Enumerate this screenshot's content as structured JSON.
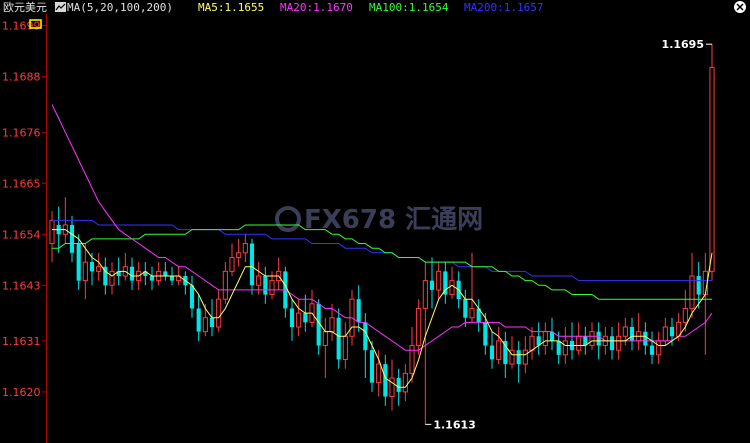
{
  "header": {
    "symbol": "欧元美元",
    "indicator": "MA(5,20,100,200)",
    "ma5": "MA5:1.1655",
    "ma20": "MA20:1.1670",
    "ma100": "MA100:1.1654",
    "ma200": "MA200:1.1657",
    "ma_icon": "line-chart-icon",
    "tool_icon": "square-tool-icon"
  },
  "watermark": "FX678 汇通网",
  "colors": {
    "background": "#000000",
    "axis": "#b00000",
    "up": "#ff3b3b",
    "down": "#00e5e5",
    "ma5": "#ffff66",
    "ma20": "#ff33ff",
    "ma100": "#33ff33",
    "ma200": "#3333ff"
  },
  "chart_data": {
    "type": "candlestick",
    "ylim": [
      1.1612,
      1.17
    ],
    "y_ticks": [
      "1.1699",
      "1.1688",
      "1.1676",
      "1.1665",
      "1.1654",
      "1.1643",
      "1.1631",
      "1.1620"
    ],
    "annotations": [
      {
        "text": "1.1695",
        "value": 1.1695,
        "index": 99
      },
      {
        "text": "1.1613",
        "value": 1.1613,
        "index": 56
      }
    ],
    "candles": [
      [
        1.1652,
        1.1657,
        1.1659,
        1.1648
      ],
      [
        1.1656,
        1.1654,
        1.166,
        1.165
      ],
      [
        1.1654,
        1.1656,
        1.1662,
        1.1652
      ],
      [
        1.1656,
        1.165,
        1.1658,
        1.1648
      ],
      [
        1.1652,
        1.1644,
        1.1654,
        1.1642
      ],
      [
        1.1644,
        1.1648,
        1.1652,
        1.164
      ],
      [
        1.1648,
        1.1646,
        1.165,
        1.1643
      ],
      [
        1.1646,
        1.1647,
        1.165,
        1.1644
      ],
      [
        1.1647,
        1.1643,
        1.1649,
        1.1641
      ],
      [
        1.1643,
        1.1646,
        1.1648,
        1.1641
      ],
      [
        1.1646,
        1.1645,
        1.1649,
        1.1643
      ],
      [
        1.1645,
        1.1647,
        1.165,
        1.1644
      ],
      [
        1.1647,
        1.1644,
        1.1649,
        1.1642
      ],
      [
        1.1644,
        1.1646,
        1.1648,
        1.1642
      ],
      [
        1.1646,
        1.1645,
        1.1648,
        1.1643
      ],
      [
        1.1645,
        1.1644,
        1.1647,
        1.1642
      ],
      [
        1.1644,
        1.1646,
        1.1648,
        1.1643
      ],
      [
        1.1646,
        1.1645,
        1.1648,
        1.1644
      ],
      [
        1.1645,
        1.1644,
        1.1647,
        1.1643
      ],
      [
        1.1644,
        1.1645,
        1.1647,
        1.1643
      ],
      [
        1.1645,
        1.1643,
        1.1646,
        1.1641
      ],
      [
        1.1643,
        1.1638,
        1.1645,
        1.1636
      ],
      [
        1.1638,
        1.1633,
        1.1641,
        1.1631
      ],
      [
        1.1633,
        1.1636,
        1.1639,
        1.1632
      ],
      [
        1.1636,
        1.1634,
        1.164,
        1.1632
      ],
      [
        1.1634,
        1.164,
        1.1642,
        1.1633
      ],
      [
        1.164,
        1.1646,
        1.1648,
        1.1639
      ],
      [
        1.1646,
        1.1649,
        1.1652,
        1.1645
      ],
      [
        1.1649,
        1.165,
        1.1653,
        1.1647
      ],
      [
        1.165,
        1.1652,
        1.1654,
        1.1648
      ],
      [
        1.1652,
        1.1643,
        1.1653,
        1.1641
      ],
      [
        1.1643,
        1.1645,
        1.1648,
        1.1641
      ],
      [
        1.1645,
        1.1641,
        1.1647,
        1.1639
      ],
      [
        1.1641,
        1.1644,
        1.1646,
        1.164
      ],
      [
        1.1644,
        1.1646,
        1.1649,
        1.1642
      ],
      [
        1.1646,
        1.1638,
        1.1647,
        1.1636
      ],
      [
        1.1638,
        1.1634,
        1.164,
        1.1631
      ],
      [
        1.1634,
        1.1637,
        1.164,
        1.1632
      ],
      [
        1.1637,
        1.1635,
        1.1641,
        1.1633
      ],
      [
        1.1635,
        1.1639,
        1.1642,
        1.1634
      ],
      [
        1.1639,
        1.163,
        1.164,
        1.1628
      ],
      [
        1.163,
        1.1633,
        1.1636,
        1.1623
      ],
      [
        1.1633,
        1.1636,
        1.1639,
        1.1631
      ],
      [
        1.1636,
        1.1627,
        1.1638,
        1.1625
      ],
      [
        1.1627,
        1.1632,
        1.1635,
        1.1625
      ],
      [
        1.1632,
        1.164,
        1.1642,
        1.163
      ],
      [
        1.164,
        1.1635,
        1.1643,
        1.1633
      ],
      [
        1.1635,
        1.1629,
        1.1637,
        1.1623
      ],
      [
        1.1629,
        1.1622,
        1.1631,
        1.162
      ],
      [
        1.1622,
        1.1626,
        1.1629,
        1.1619
      ],
      [
        1.1626,
        1.1619,
        1.1628,
        1.1617
      ],
      [
        1.1619,
        1.1623,
        1.1627,
        1.1616
      ],
      [
        1.1623,
        1.162,
        1.1625,
        1.1617
      ],
      [
        1.162,
        1.1624,
        1.1626,
        1.1618
      ],
      [
        1.1624,
        1.163,
        1.1634,
        1.1622
      ],
      [
        1.163,
        1.1638,
        1.164,
        1.1628
      ],
      [
        1.1638,
        1.1644,
        1.1648,
        1.1613
      ],
      [
        1.1644,
        1.1642,
        1.1649,
        1.1638
      ],
      [
        1.1642,
        1.1646,
        1.1648,
        1.164
      ],
      [
        1.1646,
        1.1641,
        1.1648,
        1.1639
      ],
      [
        1.1641,
        1.1644,
        1.1647,
        1.164
      ],
      [
        1.1644,
        1.164,
        1.1646,
        1.1638
      ],
      [
        1.164,
        1.1636,
        1.1642,
        1.1634
      ],
      [
        1.1636,
        1.1638,
        1.165,
        1.1635
      ],
      [
        1.1638,
        1.1635,
        1.164,
        1.1633
      ],
      [
        1.1635,
        1.163,
        1.1637,
        1.1628
      ],
      [
        1.163,
        1.1627,
        1.1633,
        1.1625
      ],
      [
        1.1627,
        1.1631,
        1.1634,
        1.1626
      ],
      [
        1.1631,
        1.1626,
        1.1633,
        1.1623
      ],
      [
        1.1626,
        1.1629,
        1.1632,
        1.1625
      ],
      [
        1.1629,
        1.1626,
        1.1631,
        1.1622
      ],
      [
        1.1626,
        1.1629,
        1.1632,
        1.1624
      ],
      [
        1.1629,
        1.1632,
        1.1634,
        1.1627
      ],
      [
        1.1632,
        1.163,
        1.1635,
        1.1628
      ],
      [
        1.163,
        1.1633,
        1.1635,
        1.1628
      ],
      [
        1.1633,
        1.1631,
        1.1636,
        1.1629
      ],
      [
        1.1631,
        1.1628,
        1.1633,
        1.1626
      ],
      [
        1.1628,
        1.1631,
        1.1634,
        1.1626
      ],
      [
        1.1631,
        1.1629,
        1.1635,
        1.1627
      ],
      [
        1.1629,
        1.1632,
        1.1635,
        1.1628
      ],
      [
        1.1632,
        1.163,
        1.1634,
        1.1628
      ],
      [
        1.163,
        1.1633,
        1.1635,
        1.1629
      ],
      [
        1.1633,
        1.163,
        1.1635,
        1.1627
      ],
      [
        1.163,
        1.1632,
        1.1634,
        1.1628
      ],
      [
        1.1632,
        1.1629,
        1.1634,
        1.1627
      ],
      [
        1.1629,
        1.1632,
        1.1635,
        1.1627
      ],
      [
        1.1632,
        1.1634,
        1.1636,
        1.163
      ],
      [
        1.1634,
        1.1631,
        1.1636,
        1.1629
      ],
      [
        1.1631,
        1.1633,
        1.1637,
        1.1629
      ],
      [
        1.1633,
        1.163,
        1.1635,
        1.1628
      ],
      [
        1.163,
        1.1628,
        1.1633,
        1.1626
      ],
      [
        1.1628,
        1.1631,
        1.1633,
        1.1626
      ],
      [
        1.1631,
        1.1634,
        1.1636,
        1.163
      ],
      [
        1.1634,
        1.1632,
        1.1636,
        1.163
      ],
      [
        1.1632,
        1.1635,
        1.1637,
        1.1631
      ],
      [
        1.1635,
        1.1638,
        1.1642,
        1.1633
      ],
      [
        1.1638,
        1.1645,
        1.165,
        1.1636
      ],
      [
        1.1645,
        1.1641,
        1.1648,
        1.1638
      ],
      [
        1.1641,
        1.1646,
        1.165,
        1.1628
      ],
      [
        1.1646,
        1.169,
        1.1695,
        1.1644
      ]
    ],
    "ma5": [
      1.1655,
      1.1655,
      1.1655,
      1.1654,
      1.1653,
      1.1651,
      1.1649,
      1.1648,
      1.1646,
      1.1645,
      1.1646,
      1.1646,
      1.1645,
      1.1645,
      1.1646,
      1.1645,
      1.1645,
      1.1645,
      1.1645,
      1.1645,
      1.1644,
      1.1643,
      1.1641,
      1.1638,
      1.1636,
      1.1636,
      1.1638,
      1.1641,
      1.1644,
      1.1647,
      1.1647,
      1.1646,
      1.1645,
      1.1645,
      1.1645,
      1.1643,
      1.164,
      1.1638,
      1.1637,
      1.1637,
      1.1635,
      1.1633,
      1.1633,
      1.1632,
      1.1632,
      1.1634,
      1.1634,
      1.1633,
      1.163,
      1.1627,
      1.1623,
      1.1622,
      1.1621,
      1.1621,
      1.1623,
      1.1627,
      1.1632,
      1.1636,
      1.164,
      1.1642,
      1.1643,
      1.1642,
      1.164,
      1.164,
      1.1638,
      1.1636,
      1.1633,
      1.1632,
      1.163,
      1.1628,
      1.1628,
      1.1628,
      1.1629,
      1.163,
      1.1631,
      1.1631,
      1.1631,
      1.163,
      1.163,
      1.163,
      1.163,
      1.1631,
      1.1631,
      1.1631,
      1.1631,
      1.1631,
      1.1631,
      1.1632,
      1.1632,
      1.1632,
      1.1631,
      1.163,
      1.163,
      1.1631,
      1.1632,
      1.1634,
      1.1637,
      1.1639,
      1.1641,
      1.165
    ],
    "ma20": [
      1.1682,
      1.1679,
      1.1676,
      1.1673,
      1.167,
      1.1667,
      1.1664,
      1.1661,
      1.1659,
      1.1657,
      1.1655,
      1.1654,
      1.1653,
      1.1652,
      1.1651,
      1.165,
      1.1649,
      1.1649,
      1.1648,
      1.1647,
      1.1647,
      1.1646,
      1.1645,
      1.1644,
      1.1643,
      1.1642,
      1.1642,
      1.1642,
      1.1642,
      1.1642,
      1.1642,
      1.1642,
      1.1642,
      1.1642,
      1.1642,
      1.1642,
      1.1641,
      1.164,
      1.164,
      1.164,
      1.1639,
      1.1638,
      1.1638,
      1.1637,
      1.1636,
      1.1636,
      1.1635,
      1.1635,
      1.1634,
      1.1633,
      1.1632,
      1.1631,
      1.163,
      1.1629,
      1.1629,
      1.1629,
      1.163,
      1.1631,
      1.1632,
      1.1633,
      1.1634,
      1.1634,
      1.1635,
      1.1635,
      1.1635,
      1.1635,
      1.1635,
      1.1635,
      1.1634,
      1.1634,
      1.1634,
      1.1634,
      1.1633,
      1.1633,
      1.1633,
      1.1633,
      1.1632,
      1.1632,
      1.1632,
      1.1632,
      1.1632,
      1.1632,
      1.1632,
      1.1631,
      1.1631,
      1.1631,
      1.1631,
      1.1631,
      1.1631,
      1.1631,
      1.1631,
      1.1631,
      1.1631,
      1.1631,
      1.1632,
      1.1632,
      1.1633,
      1.1634,
      1.1635,
      1.1637
    ],
    "ma100": [
      1.1651,
      1.1651,
      1.1652,
      1.1652,
      1.1652,
      1.1652,
      1.1653,
      1.1653,
      1.1653,
      1.1653,
      1.1653,
      1.1653,
      1.1653,
      1.1653,
      1.1654,
      1.1654,
      1.1654,
      1.1654,
      1.1654,
      1.1654,
      1.1654,
      1.1655,
      1.1655,
      1.1655,
      1.1655,
      1.1655,
      1.1655,
      1.1655,
      1.1655,
      1.1656,
      1.1656,
      1.1656,
      1.1656,
      1.1656,
      1.1656,
      1.1656,
      1.1656,
      1.1656,
      1.1655,
      1.1655,
      1.1655,
      1.1655,
      1.1654,
      1.1654,
      1.1653,
      1.1653,
      1.1652,
      1.1652,
      1.1651,
      1.1651,
      1.165,
      1.165,
      1.1649,
      1.1649,
      1.1649,
      1.1649,
      1.1648,
      1.1648,
      1.1648,
      1.1648,
      1.1648,
      1.1648,
      1.1648,
      1.1647,
      1.1647,
      1.1647,
      1.1647,
      1.1646,
      1.1646,
      1.1645,
      1.1645,
      1.1644,
      1.1644,
      1.1643,
      1.1643,
      1.1642,
      1.1642,
      1.1642,
      1.1641,
      1.1641,
      1.1641,
      1.1641,
      1.164,
      1.164,
      1.164,
      1.164,
      1.164,
      1.164,
      1.164,
      1.164,
      1.164,
      1.164,
      1.164,
      1.164,
      1.164,
      1.164,
      1.164,
      1.164,
      1.164,
      1.164
    ],
    "ma200": [
      1.1657,
      1.1657,
      1.1657,
      1.1657,
      1.1657,
      1.1657,
      1.1657,
      1.1656,
      1.1656,
      1.1656,
      1.1656,
      1.1656,
      1.1656,
      1.1656,
      1.1656,
      1.1656,
      1.1656,
      1.1656,
      1.1656,
      1.1655,
      1.1655,
      1.1655,
      1.1655,
      1.1655,
      1.1655,
      1.1655,
      1.1654,
      1.1654,
      1.1654,
      1.1654,
      1.1654,
      1.1654,
      1.1654,
      1.1653,
      1.1653,
      1.1653,
      1.1653,
      1.1653,
      1.1653,
      1.1652,
      1.1652,
      1.1652,
      1.1652,
      1.1652,
      1.1651,
      1.1651,
      1.1651,
      1.1651,
      1.165,
      1.165,
      1.165,
      1.165,
      1.1649,
      1.1649,
      1.1649,
      1.1649,
      1.1648,
      1.1648,
      1.1648,
      1.1648,
      1.1648,
      1.1647,
      1.1647,
      1.1647,
      1.1647,
      1.1647,
      1.1646,
      1.1646,
      1.1646,
      1.1646,
      1.1646,
      1.1646,
      1.1645,
      1.1645,
      1.1645,
      1.1645,
      1.1645,
      1.1645,
      1.1645,
      1.1644,
      1.1644,
      1.1644,
      1.1644,
      1.1644,
      1.1644,
      1.1644,
      1.1644,
      1.1644,
      1.1644,
      1.1644,
      1.1644,
      1.1644,
      1.1644,
      1.1644,
      1.1644,
      1.1644,
      1.1644,
      1.1644,
      1.1644,
      1.1644
    ]
  }
}
